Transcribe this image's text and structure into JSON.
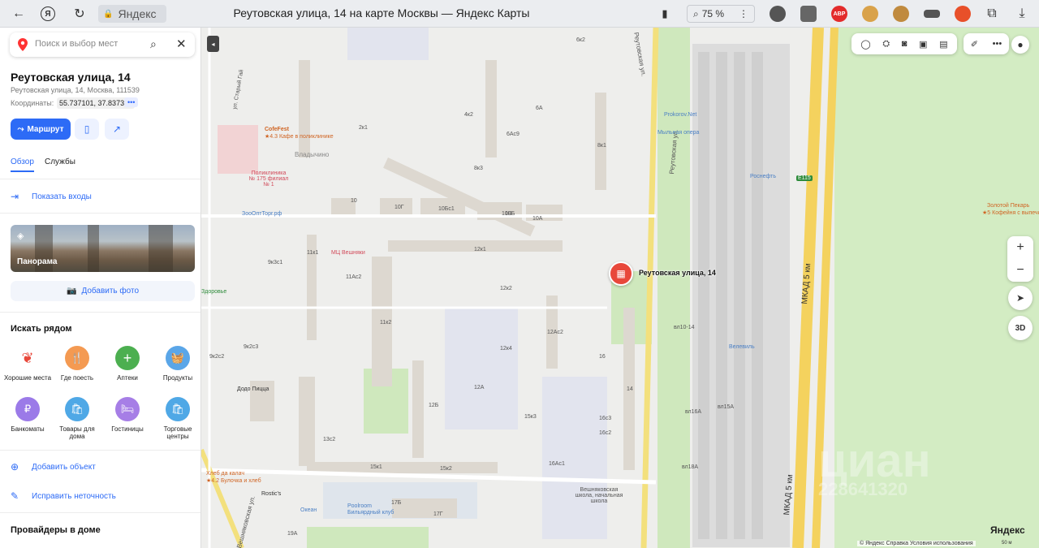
{
  "browser": {
    "url_host": "Яндекс",
    "page_title": "Реутовская улица, 14 на карте Москвы — Яндекс Карты",
    "zoom": "75 %"
  },
  "sidebar": {
    "search_placeholder": "Поиск и выбор мест",
    "address_title": "Реутовская улица, 14",
    "address_full": "Реутовская улица, 14, Москва, 111539",
    "coords_label": "Координаты:",
    "coords_value": "55.737101, 37.837372",
    "coords_more": "•••",
    "route_label": "Маршрут",
    "tabs": [
      {
        "label": "Обзор"
      },
      {
        "label": "Службы"
      }
    ],
    "show_entrances": "Показать входы",
    "panorama_label": "Панорама",
    "add_photo": "Добавить фото",
    "nearby_title": "Искать рядом",
    "nearby": [
      {
        "label": "Хорошие места",
        "color": "#ffffff"
      },
      {
        "label": "Где поесть",
        "color": "#f49a52"
      },
      {
        "label": "Аптеки",
        "color": "#4caf50"
      },
      {
        "label": "Продукты",
        "color": "#5aa6e8"
      },
      {
        "label": "Банкоматы",
        "color": "#9b7ae8"
      },
      {
        "label": "Товары для дома",
        "color": "#4fa8e6"
      },
      {
        "label": "Гостиницы",
        "color": "#a67ee6"
      },
      {
        "label": "Торговые центры",
        "color": "#4fa8e6"
      }
    ],
    "add_object": "Добавить объект",
    "fix_error": "Исправить неточность",
    "providers_title": "Провайдеры в доме"
  },
  "map": {
    "marker_label": "Реутовская улица, 14",
    "streets": [
      "Реутовская ул.",
      "Реутовская ул.",
      "МКАД 5 км",
      "МКАД 5 км",
      "Вешняковская ул.",
      "ул. Старый Гай"
    ],
    "road_badge": "E115",
    "district": "Вешняки",
    "area_label": "Владычино",
    "pois": [
      {
        "label": "CofeFest",
        "sub": "★4.3 Кафе в поликлинике"
      },
      {
        "label": "Поликлиника № 175 филиал № 1"
      },
      {
        "label": "ЗооОптТорг.рф"
      },
      {
        "label": "МЦ Вешняки"
      },
      {
        "label": "Додо Пицца"
      },
      {
        "label": "Prokorov.Net"
      },
      {
        "label": "Мыльная опера"
      },
      {
        "label": "Роснефть"
      },
      {
        "label": "Велевиль"
      },
      {
        "label": "Хлеб да калач",
        "sub": "★4.2 Булочка и хлеб"
      },
      {
        "label": "Rostic's"
      },
      {
        "label": "Океан"
      },
      {
        "label": "Poolroom",
        "sub": "Бильярдный клуб"
      },
      {
        "label": "Вешняковская школа, начальная школа"
      },
      {
        "label": "Золотой Пекарь",
        "sub": "★5 Кофейня с выпечкой"
      },
      {
        "label": "Здоровье"
      }
    ],
    "building_numbers": [
      "6к2",
      "6А",
      "6Ас9",
      "8к3",
      "8к1",
      "10",
      "10Б",
      "10Г",
      "10Бс1",
      "10В",
      "10А",
      "12к1",
      "12к2",
      "12к4",
      "12Ас2",
      "12А",
      "12Б",
      "14",
      "16",
      "16с3",
      "16с2",
      "16Ас1",
      "15к3",
      "15к2",
      "15к1",
      "17Б",
      "17Г",
      "19А",
      "13с2",
      "11к2",
      "11к1",
      "11Ас2",
      "9к3с1",
      "9к2с2",
      "9к2с3",
      "4к2",
      "2к1",
      "вл10-14",
      "вл15А",
      "вл18А",
      "вл16А"
    ],
    "three_d": "3D",
    "footer": "© Яндекс   Справка   Условия использования",
    "logo": "Яндекс",
    "scale": "50 м",
    "watermark": "циан",
    "watermark_num": "228641320"
  }
}
